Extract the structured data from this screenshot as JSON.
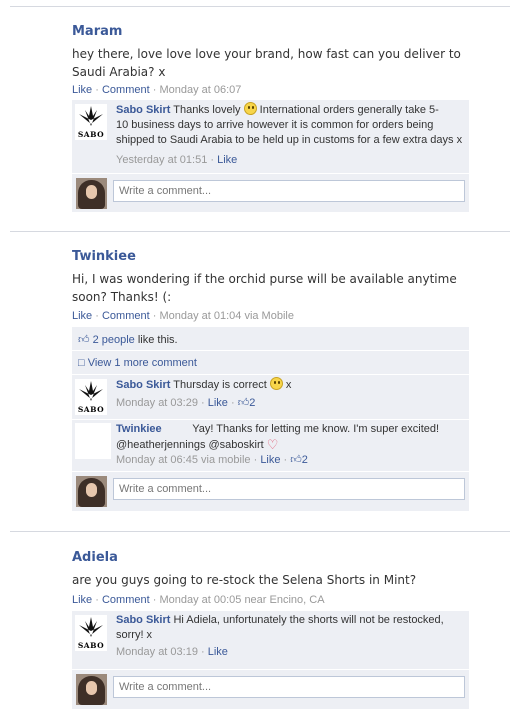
{
  "posts": [
    {
      "author": "Maram",
      "message_line1": "hey there, love love love your brand, how fast can you deliver to",
      "message_line2": "Saudi Arabia? x",
      "like": "Like",
      "comment": "Comment",
      "time": "Monday at 06:07",
      "replies": [
        {
          "logo_text": "SABO",
          "author": "Sabo Skirt",
          "line1": "Thanks lovely",
          "line1b": "International orders generally take 5-",
          "line2": "10 business days to arrive however it is common for orders being",
          "line3": "shipped to Saudi Arabia to be held up in customs for a few extra days x",
          "time": "Yesterday at 01:51",
          "like": "Like"
        }
      ],
      "comment_placeholder": "Write a comment..."
    },
    {
      "author": "Twinkiee",
      "message_line1": "Hi, I was wondering if the orchid purse will be available anytime",
      "message_line2": "soon? Thanks! (:",
      "like": "Like",
      "comment": "Comment",
      "time": "Monday at 01:04 via Mobile",
      "likes_link": "2 people",
      "likes_text": "like this.",
      "view_more": "View 1 more comment",
      "replies": [
        {
          "logo_text": "SABO",
          "author": "Sabo Skirt",
          "line1": "Thursday is correct",
          "line1_suffix": "x",
          "time": "Monday at 03:29",
          "like": "Like",
          "like_count": "2"
        },
        {
          "author": "Twinkiee",
          "line1": "Yay! Thanks for letting me know. I'm super excited!",
          "line2": "@heatherjennings @saboskirt",
          "time": "Monday at 06:45 via mobile",
          "like": "Like",
          "like_count": "2"
        }
      ],
      "comment_placeholder": "Write a comment..."
    },
    {
      "author": "Adiela",
      "message_line1": "are you guys going to re-stock the Selena Shorts in Mint?",
      "like": "Like",
      "comment": "Comment",
      "time": "Monday at 00:05 near Encino, CA",
      "replies": [
        {
          "logo_text": "SABO",
          "author": "Sabo Skirt",
          "line1": "Hi Adiela, unfortunately the shorts will not be restocked,",
          "line2": "sorry! x",
          "time": "Monday at 03:19",
          "like": "Like"
        }
      ],
      "comment_placeholder": "Write a comment..."
    }
  ],
  "colors": {
    "link": "#3b5998",
    "box": "#edeff4",
    "meta": "#999999"
  }
}
